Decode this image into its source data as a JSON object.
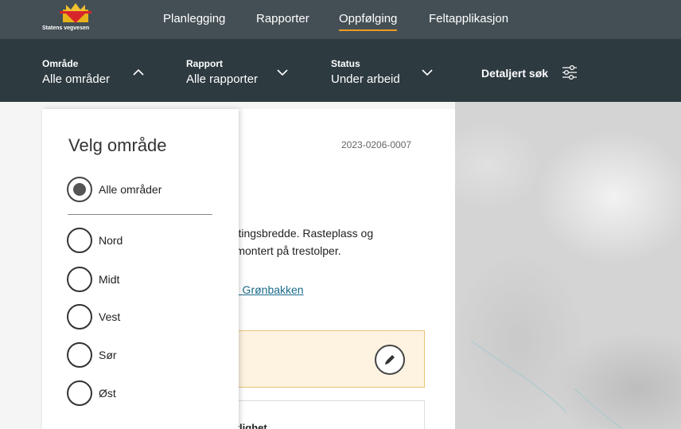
{
  "header": {
    "logo_text": "Statens vegvesen",
    "nav": [
      "Planlegging",
      "Rapporter",
      "Oppfølging",
      "Feltapplikasjon"
    ],
    "active_index": 2,
    "accent_color": "#ed9c22"
  },
  "filters": {
    "area": {
      "label": "Område",
      "value": "Alle områder",
      "icon": "chevron-up-icon"
    },
    "report": {
      "label": "Rapport",
      "value": "Alle rapporter",
      "icon": "chevron-down-icon"
    },
    "status": {
      "label": "Status",
      "value": "Under arbeid",
      "icon": "chevron-down-icon"
    },
    "detailed_search": {
      "label": "Detaljert søk",
      "icon": "sliders-icon"
    }
  },
  "card": {
    "report_id": "2023-0206-0007",
    "description_lines": [
      "nfestingsbredde. Rasteplass og",
      "erk montert på trestolper."
    ],
    "link": "- Grønbakken",
    "edit_icon": "pencil-icon",
    "section_label": "rlighet"
  },
  "area_panel": {
    "title": "Velg område",
    "options": [
      {
        "label": "Alle områder",
        "checked": true
      },
      {
        "label": "Nord",
        "checked": false
      },
      {
        "label": "Midt",
        "checked": false
      },
      {
        "label": "Vest",
        "checked": false
      },
      {
        "label": "Sør",
        "checked": false
      },
      {
        "label": "Øst",
        "checked": false
      }
    ]
  }
}
